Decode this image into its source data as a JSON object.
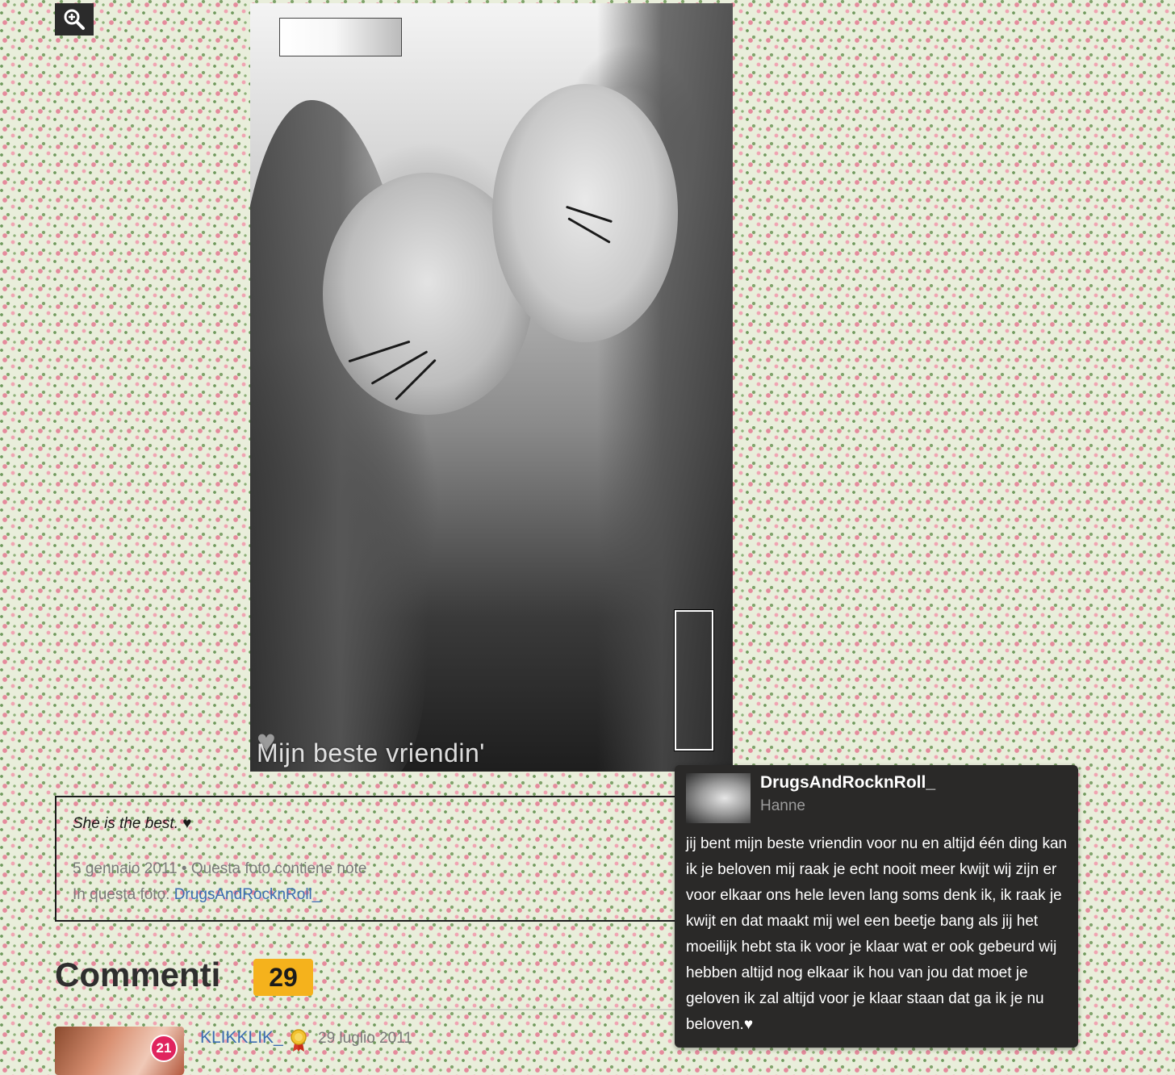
{
  "photo": {
    "caption": "Mijn beste vriendin'"
  },
  "zoom": {
    "icon": "zoom-in-icon"
  },
  "info": {
    "description": "She is the best.",
    "description_icon": "♥",
    "meta": "5 gennaio 2011 • Questa foto contiene note",
    "people_label": "In questa foto:",
    "people_link": "DrugsAndRocknRoll_"
  },
  "comments": {
    "title": "Commenti",
    "count": "29",
    "first": {
      "badge": "21",
      "user": "KLIKKLIK_",
      "date": "29 luglio 2011"
    }
  },
  "tooltip": {
    "user": "DrugsAndRocknRoll_",
    "name": "Hanne",
    "text": "jij bent mijn beste vriendin voor nu en altijd één ding kan ik je beloven mij raak je echt nooit meer kwijt wij zijn er voor elkaar ons hele leven lang soms denk ik, ik raak je kwijt en dat maakt mij wel een beetje bang als jij het moeilijk hebt sta ik voor je klaar wat er ook gebeurd wij hebben altijd nog elkaar ik hou van jou dat moet je geloven ik zal altijd voor je klaar staan dat ga ik je nu beloven.♥"
  },
  "colors": {
    "accent": "#f5b21c",
    "link": "#3b6db2",
    "badge": "#e0245e",
    "tooltip_bg": "#2a2928"
  }
}
